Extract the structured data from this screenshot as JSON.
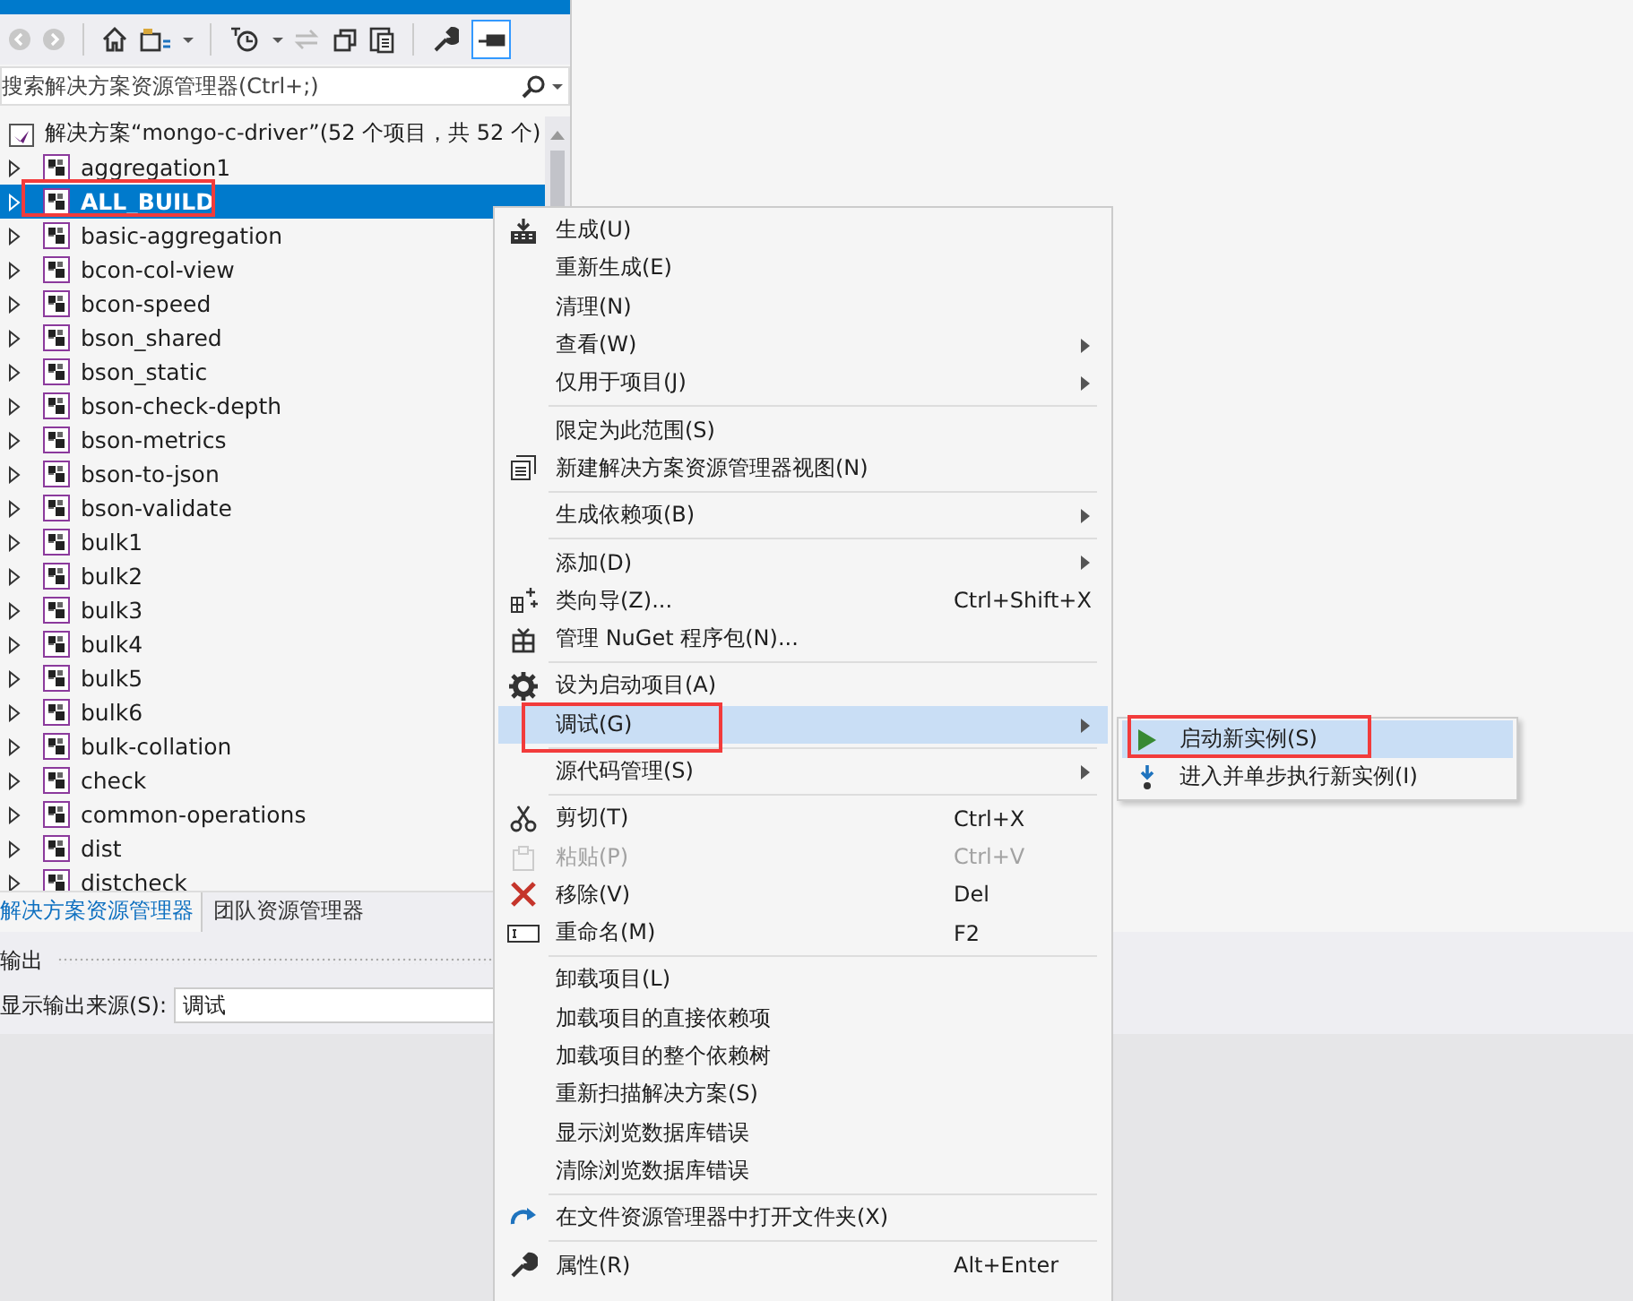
{
  "explorer": {
    "search": {
      "placeholder": "搜索解决方案资源管理器(Ctrl+;)"
    },
    "solution": {
      "label": "解决方案“mongo-c-driver”(52 个项目，共 52 个)"
    },
    "projects": [
      {
        "label": "aggregation1",
        "selected": false,
        "expanded": false,
        "highlighted": false
      },
      {
        "label": "ALL_BUILD",
        "selected": true,
        "expanded": false,
        "highlighted": true
      },
      {
        "label": "basic-aggregation",
        "selected": false,
        "expanded": false,
        "highlighted": false
      },
      {
        "label": "bcon-col-view",
        "selected": false,
        "expanded": false,
        "highlighted": false
      },
      {
        "label": "bcon-speed",
        "selected": false,
        "expanded": false,
        "highlighted": false
      },
      {
        "label": "bson_shared",
        "selected": false,
        "expanded": false,
        "highlighted": false
      },
      {
        "label": "bson_static",
        "selected": false,
        "expanded": false,
        "highlighted": false
      },
      {
        "label": "bson-check-depth",
        "selected": false,
        "expanded": false,
        "highlighted": false
      },
      {
        "label": "bson-metrics",
        "selected": false,
        "expanded": false,
        "highlighted": false
      },
      {
        "label": "bson-to-json",
        "selected": false,
        "expanded": false,
        "highlighted": false
      },
      {
        "label": "bson-validate",
        "selected": false,
        "expanded": false,
        "highlighted": false
      },
      {
        "label": "bulk1",
        "selected": false,
        "expanded": false,
        "highlighted": false
      },
      {
        "label": "bulk2",
        "selected": false,
        "expanded": false,
        "highlighted": false
      },
      {
        "label": "bulk3",
        "selected": false,
        "expanded": false,
        "highlighted": false
      },
      {
        "label": "bulk4",
        "selected": false,
        "expanded": false,
        "highlighted": false
      },
      {
        "label": "bulk5",
        "selected": false,
        "expanded": false,
        "highlighted": false
      },
      {
        "label": "bulk6",
        "selected": false,
        "expanded": false,
        "highlighted": false
      },
      {
        "label": "bulk-collation",
        "selected": false,
        "expanded": false,
        "highlighted": false
      },
      {
        "label": "check",
        "selected": false,
        "expanded": false,
        "highlighted": false
      },
      {
        "label": "common-operations",
        "selected": false,
        "expanded": false,
        "highlighted": false
      },
      {
        "label": "dist",
        "selected": false,
        "expanded": false,
        "highlighted": false
      },
      {
        "label": "distcheck",
        "selected": false,
        "expanded": false,
        "highlighted": false
      }
    ],
    "tabs": [
      {
        "label": "解决方案资源管理器",
        "selected": true
      },
      {
        "label": "团队资源管理器",
        "selected": false
      }
    ]
  },
  "output": {
    "title": "输出",
    "source_label": "显示输出来源(S):",
    "source_value": "调试"
  },
  "context_menu": [
    {
      "kind": "item",
      "label": "生成(U)",
      "submenu": false,
      "disabled": false,
      "selected": false,
      "highlighted": false
    },
    {
      "kind": "item",
      "label": "重新生成(E)",
      "submenu": false,
      "disabled": false,
      "selected": false,
      "highlighted": false
    },
    {
      "kind": "item",
      "label": "清理(N)",
      "submenu": false,
      "disabled": false,
      "selected": false,
      "highlighted": false
    },
    {
      "kind": "item",
      "label": "查看(W)",
      "submenu": true,
      "disabled": false,
      "selected": false,
      "highlighted": false
    },
    {
      "kind": "item",
      "label": "仅用于项目(J)",
      "submenu": true,
      "disabled": false,
      "selected": false,
      "highlighted": false
    },
    {
      "kind": "separator"
    },
    {
      "kind": "item",
      "label": "限定为此范围(S)",
      "submenu": false,
      "disabled": false,
      "selected": false,
      "highlighted": false
    },
    {
      "kind": "item",
      "label": "新建解决方案资源管理器视图(N)",
      "submenu": false,
      "disabled": false,
      "selected": false,
      "highlighted": false
    },
    {
      "kind": "separator"
    },
    {
      "kind": "item",
      "label": "生成依赖项(B)",
      "submenu": true,
      "disabled": false,
      "selected": false,
      "highlighted": false
    },
    {
      "kind": "separator"
    },
    {
      "kind": "item",
      "label": "添加(D)",
      "submenu": true,
      "disabled": false,
      "selected": false,
      "highlighted": false
    },
    {
      "kind": "item",
      "label": "类向导(Z)...",
      "shortcut": "Ctrl+Shift+X",
      "submenu": false,
      "disabled": false,
      "selected": false,
      "highlighted": false
    },
    {
      "kind": "item",
      "label": "管理 NuGet 程序包(N)...",
      "submenu": false,
      "disabled": false,
      "selected": false,
      "highlighted": false
    },
    {
      "kind": "separator"
    },
    {
      "kind": "item",
      "label": "设为启动项目(A)",
      "submenu": false,
      "disabled": false,
      "selected": false,
      "highlighted": false
    },
    {
      "kind": "item",
      "label": "调试(G)",
      "submenu": true,
      "disabled": false,
      "selected": true,
      "highlighted": true
    },
    {
      "kind": "separator"
    },
    {
      "kind": "item",
      "label": "源代码管理(S)",
      "submenu": true,
      "disabled": false,
      "selected": false,
      "highlighted": false
    },
    {
      "kind": "separator"
    },
    {
      "kind": "item",
      "label": "剪切(T)",
      "shortcut": "Ctrl+X",
      "submenu": false,
      "disabled": false,
      "selected": false,
      "highlighted": false
    },
    {
      "kind": "item",
      "label": "粘贴(P)",
      "shortcut": "Ctrl+V",
      "submenu": false,
      "disabled": true,
      "selected": false,
      "highlighted": false
    },
    {
      "kind": "item",
      "label": "移除(V)",
      "shortcut": "Del",
      "submenu": false,
      "disabled": false,
      "selected": false,
      "highlighted": false
    },
    {
      "kind": "item",
      "label": "重命名(M)",
      "shortcut": "F2",
      "submenu": false,
      "disabled": false,
      "selected": false,
      "highlighted": false
    },
    {
      "kind": "separator"
    },
    {
      "kind": "item",
      "label": "卸载项目(L)",
      "submenu": false,
      "disabled": false,
      "selected": false,
      "highlighted": false
    },
    {
      "kind": "item",
      "label": "加载项目的直接依赖项",
      "submenu": false,
      "disabled": false,
      "selected": false,
      "highlighted": false
    },
    {
      "kind": "item",
      "label": "加载项目的整个依赖树",
      "submenu": false,
      "disabled": false,
      "selected": false,
      "highlighted": false
    },
    {
      "kind": "item",
      "label": "重新扫描解决方案(S)",
      "submenu": false,
      "disabled": false,
      "selected": false,
      "highlighted": false
    },
    {
      "kind": "item",
      "label": "显示浏览数据库错误",
      "submenu": false,
      "disabled": false,
      "selected": false,
      "highlighted": false
    },
    {
      "kind": "item",
      "label": "清除浏览数据库错误",
      "submenu": false,
      "disabled": false,
      "selected": false,
      "highlighted": false
    },
    {
      "kind": "separator"
    },
    {
      "kind": "item",
      "label": "在文件资源管理器中打开文件夹(X)",
      "submenu": false,
      "disabled": false,
      "selected": false,
      "highlighted": false
    },
    {
      "kind": "separator"
    },
    {
      "kind": "item",
      "label": "属性(R)",
      "shortcut": "Alt+Enter",
      "submenu": false,
      "disabled": false,
      "selected": false,
      "highlighted": false
    }
  ],
  "submenu": [
    {
      "label": "启动新实例(S)",
      "selected": true,
      "highlighted": true
    },
    {
      "label": "进入并单步执行新实例(I)",
      "selected": false,
      "highlighted": false
    }
  ]
}
